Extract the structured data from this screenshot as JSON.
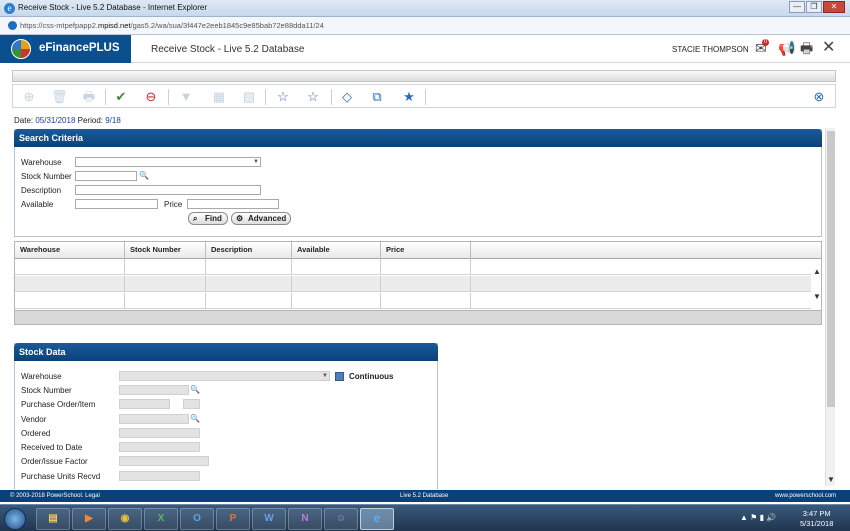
{
  "window": {
    "title": "Receive Stock - Live 5.2 Database - Internet Explorer",
    "url_prefix": "https://css-mtpefpapp2.",
    "url_domain": "mpisd.net",
    "url_path": "/gas5.2/wa/sua/3f447e2eeb1845c9e85bab72e88dda11/24",
    "minimize": "—",
    "restore": "❐",
    "close": "✕"
  },
  "header": {
    "brand": "eFinancePLUS",
    "page_title": "Receive Stock - Live 5.2 Database",
    "user": "STACIE THOMPSON",
    "notification_count": "0"
  },
  "period_bar": {
    "date_label": "Date:",
    "date_value": "05/31/2018",
    "period_label": "Period:",
    "period_value": "9/18"
  },
  "search_criteria": {
    "title": "Search Criteria",
    "warehouse_label": "Warehouse",
    "warehouse_value": "",
    "stock_number_label": "Stock Number",
    "description_label": "Description",
    "available_label": "Available",
    "price_label": "Price",
    "find_button": "Find",
    "advanced_button": "Advanced"
  },
  "results_grid": {
    "columns": [
      "Warehouse",
      "Stock Number",
      "Description",
      "Available",
      "Price"
    ],
    "rows": [
      [
        "",
        "",
        "",
        "",
        ""
      ],
      [
        "",
        "",
        "",
        "",
        ""
      ],
      [
        "",
        "",
        "",
        "",
        ""
      ]
    ]
  },
  "stock_data": {
    "title": "Stock Data",
    "warehouse_label": "Warehouse",
    "continuous_label": "Continuous",
    "continuous_checked": true,
    "stock_number_label": "Stock Number",
    "po_item_label": "Purchase Order/Item",
    "vendor_label": "Vendor",
    "ordered_label": "Ordered",
    "received_to_date_label": "Received to Date",
    "order_issue_factor_label": "Order/Issue Factor",
    "purchase_units_recvd_label": "Purchase Units Recvd"
  },
  "footer": {
    "copyright": "© 2003-2018 PowerSchool. Legal",
    "database": "Live 5.2 Database",
    "site": "www.powerschool.com"
  },
  "taskbar": {
    "apps": [
      "explorer",
      "media-player",
      "chrome",
      "excel",
      "outlook",
      "powerpoint",
      "word",
      "onenote",
      "lync",
      "internet-explorer"
    ],
    "app_glyphs": [
      "▤",
      "▶",
      "◉",
      "X",
      "O",
      "P",
      "W",
      "N",
      "☺",
      "e"
    ],
    "time": "3:47 PM",
    "date": "5/31/2018"
  },
  "colors": {
    "header_blue": "#0b4179",
    "link_blue": "#1d3fa0",
    "toolbar_icon_blue": "#2a6db5"
  }
}
